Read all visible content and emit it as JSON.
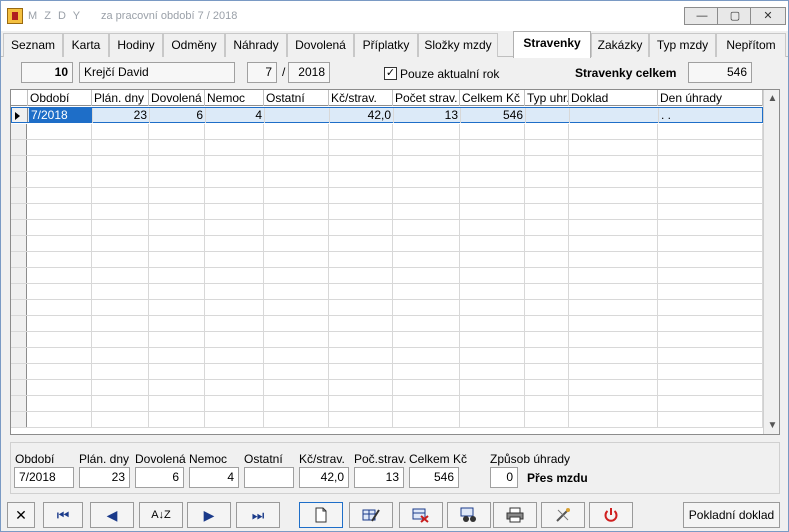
{
  "window": {
    "title": "M Z D Y",
    "subtitle": "za pracovní období  7 / 2018",
    "controls": {
      "minimize": "—",
      "maximize": "▢",
      "close": "✕"
    }
  },
  "tabs": [
    {
      "label": "Seznam"
    },
    {
      "label": "Karta"
    },
    {
      "label": "Hodiny"
    },
    {
      "label": "Odměny"
    },
    {
      "label": "Náhrady"
    },
    {
      "label": "Dovolená"
    },
    {
      "label": "Příplatky"
    },
    {
      "label": "Složky mzdy"
    },
    {
      "label": "Stravenky"
    },
    {
      "label": "Zakázky"
    },
    {
      "label": "Typ mzdy"
    },
    {
      "label": "Nepřítom"
    }
  ],
  "employee": {
    "number": "10",
    "name": "Krejčí David",
    "month": "7",
    "separator": "/",
    "year": "2018",
    "only_current_year_label": "Pouze aktualní rok",
    "only_current_year_checked": "✓",
    "total_label": "Stravenky celkem",
    "total_value": "546"
  },
  "grid": {
    "columns": [
      "Období",
      "Plán. dny",
      "Dovolená",
      "Nemoc",
      "Ostatní",
      "Kč/strav.",
      "Počet strav.",
      "Celkem Kč",
      "Typ uhr.",
      "Doklad",
      "Den úhrady"
    ],
    "rows": [
      {
        "obdobi": "7/2018",
        "plan_dny": "23",
        "dovolena": "6",
        "nemoc": "4",
        "ostatni": "",
        "kc_strav": "42,0",
        "pocet_strav": "13",
        "celkem_kc": "546",
        "typ_uhr": "",
        "doklad": "",
        "den_uhrady": ". ."
      }
    ]
  },
  "summary": {
    "labels": {
      "obdobi": "Období",
      "plan_dny": "Plán. dny",
      "dovolena": "Dovolená",
      "nemoc": "Nemoc",
      "ostatni": "Ostatní",
      "kc_strav": "Kč/strav.",
      "poc_strav": "Poč.strav.",
      "celkem_kc": "Celkem Kč",
      "zpusob": "Způsob úhrady"
    },
    "values": {
      "obdobi": "7/2018",
      "plan_dny": "23",
      "dovolena": "6",
      "nemoc": "4",
      "ostatni": "",
      "kc_strav": "42,0",
      "poc_strav": "13",
      "celkem_kc": "546",
      "zpusob_code": "0",
      "zpusob_text": "Přes mzdu"
    }
  },
  "toolbar": {
    "cancel": "✕",
    "first": "⏮",
    "prev": "◀",
    "sort": "A↓Z",
    "next": "▶",
    "last": "⏭",
    "cash_receipt": "Pokladní doklad"
  }
}
